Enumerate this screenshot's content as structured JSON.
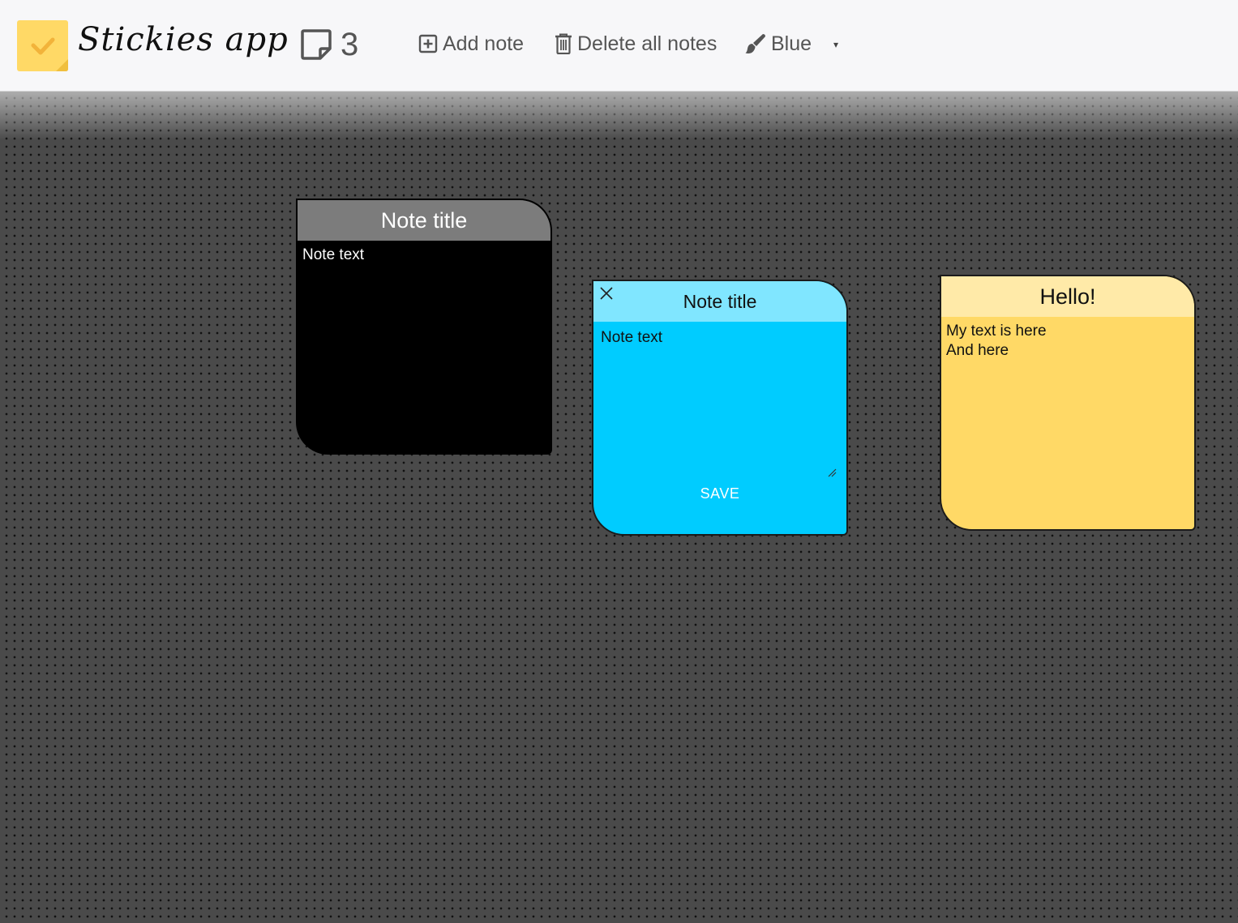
{
  "app": {
    "title": "Stickies app",
    "note_count": "3"
  },
  "toolbar": {
    "add_note_label": "Add note",
    "delete_all_label": "Delete all notes",
    "color_label": "Blue",
    "color_caret": "▾"
  },
  "icons": {
    "logo": "sticky-note-check-icon",
    "count": "note-outline-icon",
    "add": "plus-square-icon",
    "delete": "trash-icon",
    "color": "paintbrush-icon",
    "close": "close-icon",
    "resize": "resize-grip-icon"
  },
  "notes": [
    {
      "title": "Note title",
      "text": "Note text",
      "color": "black",
      "header_color": "#7c7c7c",
      "body_color": "#000000"
    },
    {
      "title": "Note title",
      "text": "Note text",
      "color": "blue",
      "header_color": "#80e6ff",
      "body_color": "#00ccff",
      "editing": true,
      "save_label": "SAVE"
    },
    {
      "title": "Hello!",
      "text": "My text is here\nAnd here",
      "color": "yellow",
      "header_color": "#ffeaa8",
      "body_color": "#ffd966"
    }
  ],
  "colors": {
    "toolbar_bg": "#f7f7f9",
    "board_bg": "#4a4a4a",
    "logo_yellow": "#ffd966"
  }
}
